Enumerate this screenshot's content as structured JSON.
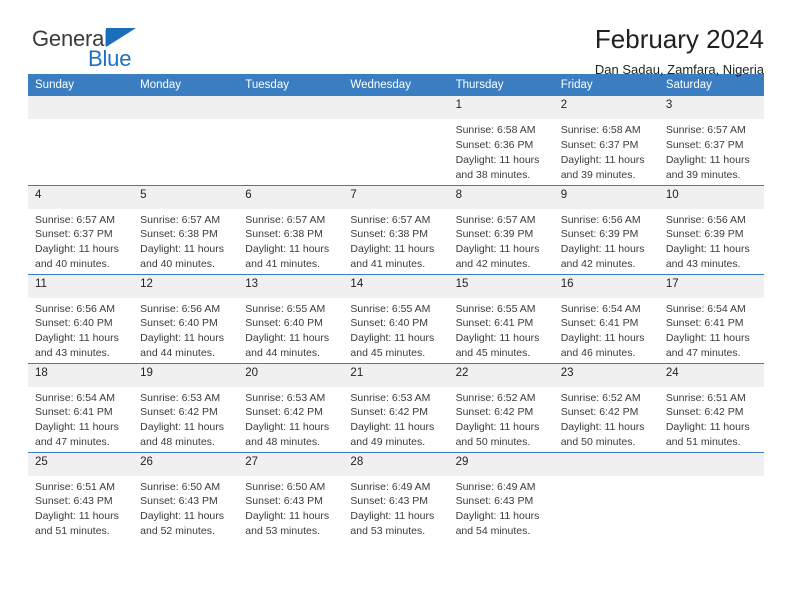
{
  "brand": {
    "name_top": "General",
    "name_bottom": "Blue",
    "accent_color": "#1a6fbd"
  },
  "header": {
    "title": "February 2024",
    "subtitle": "Dan Sadau, Zamfara, Nigeria"
  },
  "calendar": {
    "header_color": "#3a7ec1",
    "daynum_band_color": "#f0f0f0",
    "weekdays": [
      "Sunday",
      "Monday",
      "Tuesday",
      "Wednesday",
      "Thursday",
      "Friday",
      "Saturday"
    ],
    "weeks": [
      [
        {
          "day": "",
          "lines": []
        },
        {
          "day": "",
          "lines": []
        },
        {
          "day": "",
          "lines": []
        },
        {
          "day": "",
          "lines": []
        },
        {
          "day": "1",
          "lines": [
            "Sunrise: 6:58 AM",
            "Sunset: 6:36 PM",
            "Daylight: 11 hours",
            "and 38 minutes."
          ]
        },
        {
          "day": "2",
          "lines": [
            "Sunrise: 6:58 AM",
            "Sunset: 6:37 PM",
            "Daylight: 11 hours",
            "and 39 minutes."
          ]
        },
        {
          "day": "3",
          "lines": [
            "Sunrise: 6:57 AM",
            "Sunset: 6:37 PM",
            "Daylight: 11 hours",
            "and 39 minutes."
          ]
        }
      ],
      [
        {
          "day": "4",
          "lines": [
            "Sunrise: 6:57 AM",
            "Sunset: 6:37 PM",
            "Daylight: 11 hours",
            "and 40 minutes."
          ]
        },
        {
          "day": "5",
          "lines": [
            "Sunrise: 6:57 AM",
            "Sunset: 6:38 PM",
            "Daylight: 11 hours",
            "and 40 minutes."
          ]
        },
        {
          "day": "6",
          "lines": [
            "Sunrise: 6:57 AM",
            "Sunset: 6:38 PM",
            "Daylight: 11 hours",
            "and 41 minutes."
          ]
        },
        {
          "day": "7",
          "lines": [
            "Sunrise: 6:57 AM",
            "Sunset: 6:38 PM",
            "Daylight: 11 hours",
            "and 41 minutes."
          ]
        },
        {
          "day": "8",
          "lines": [
            "Sunrise: 6:57 AM",
            "Sunset: 6:39 PM",
            "Daylight: 11 hours",
            "and 42 minutes."
          ]
        },
        {
          "day": "9",
          "lines": [
            "Sunrise: 6:56 AM",
            "Sunset: 6:39 PM",
            "Daylight: 11 hours",
            "and 42 minutes."
          ]
        },
        {
          "day": "10",
          "lines": [
            "Sunrise: 6:56 AM",
            "Sunset: 6:39 PM",
            "Daylight: 11 hours",
            "and 43 minutes."
          ]
        }
      ],
      [
        {
          "day": "11",
          "lines": [
            "Sunrise: 6:56 AM",
            "Sunset: 6:40 PM",
            "Daylight: 11 hours",
            "and 43 minutes."
          ]
        },
        {
          "day": "12",
          "lines": [
            "Sunrise: 6:56 AM",
            "Sunset: 6:40 PM",
            "Daylight: 11 hours",
            "and 44 minutes."
          ]
        },
        {
          "day": "13",
          "lines": [
            "Sunrise: 6:55 AM",
            "Sunset: 6:40 PM",
            "Daylight: 11 hours",
            "and 44 minutes."
          ]
        },
        {
          "day": "14",
          "lines": [
            "Sunrise: 6:55 AM",
            "Sunset: 6:40 PM",
            "Daylight: 11 hours",
            "and 45 minutes."
          ]
        },
        {
          "day": "15",
          "lines": [
            "Sunrise: 6:55 AM",
            "Sunset: 6:41 PM",
            "Daylight: 11 hours",
            "and 45 minutes."
          ]
        },
        {
          "day": "16",
          "lines": [
            "Sunrise: 6:54 AM",
            "Sunset: 6:41 PM",
            "Daylight: 11 hours",
            "and 46 minutes."
          ]
        },
        {
          "day": "17",
          "lines": [
            "Sunrise: 6:54 AM",
            "Sunset: 6:41 PM",
            "Daylight: 11 hours",
            "and 47 minutes."
          ]
        }
      ],
      [
        {
          "day": "18",
          "lines": [
            "Sunrise: 6:54 AM",
            "Sunset: 6:41 PM",
            "Daylight: 11 hours",
            "and 47 minutes."
          ]
        },
        {
          "day": "19",
          "lines": [
            "Sunrise: 6:53 AM",
            "Sunset: 6:42 PM",
            "Daylight: 11 hours",
            "and 48 minutes."
          ]
        },
        {
          "day": "20",
          "lines": [
            "Sunrise: 6:53 AM",
            "Sunset: 6:42 PM",
            "Daylight: 11 hours",
            "and 48 minutes."
          ]
        },
        {
          "day": "21",
          "lines": [
            "Sunrise: 6:53 AM",
            "Sunset: 6:42 PM",
            "Daylight: 11 hours",
            "and 49 minutes."
          ]
        },
        {
          "day": "22",
          "lines": [
            "Sunrise: 6:52 AM",
            "Sunset: 6:42 PM",
            "Daylight: 11 hours",
            "and 50 minutes."
          ]
        },
        {
          "day": "23",
          "lines": [
            "Sunrise: 6:52 AM",
            "Sunset: 6:42 PM",
            "Daylight: 11 hours",
            "and 50 minutes."
          ]
        },
        {
          "day": "24",
          "lines": [
            "Sunrise: 6:51 AM",
            "Sunset: 6:42 PM",
            "Daylight: 11 hours",
            "and 51 minutes."
          ]
        }
      ],
      [
        {
          "day": "25",
          "lines": [
            "Sunrise: 6:51 AM",
            "Sunset: 6:43 PM",
            "Daylight: 11 hours",
            "and 51 minutes."
          ]
        },
        {
          "day": "26",
          "lines": [
            "Sunrise: 6:50 AM",
            "Sunset: 6:43 PM",
            "Daylight: 11 hours",
            "and 52 minutes."
          ]
        },
        {
          "day": "27",
          "lines": [
            "Sunrise: 6:50 AM",
            "Sunset: 6:43 PM",
            "Daylight: 11 hours",
            "and 53 minutes."
          ]
        },
        {
          "day": "28",
          "lines": [
            "Sunrise: 6:49 AM",
            "Sunset: 6:43 PM",
            "Daylight: 11 hours",
            "and 53 minutes."
          ]
        },
        {
          "day": "29",
          "lines": [
            "Sunrise: 6:49 AM",
            "Sunset: 6:43 PM",
            "Daylight: 11 hours",
            "and 54 minutes."
          ]
        },
        {
          "day": "",
          "lines": []
        },
        {
          "day": "",
          "lines": []
        }
      ]
    ]
  }
}
